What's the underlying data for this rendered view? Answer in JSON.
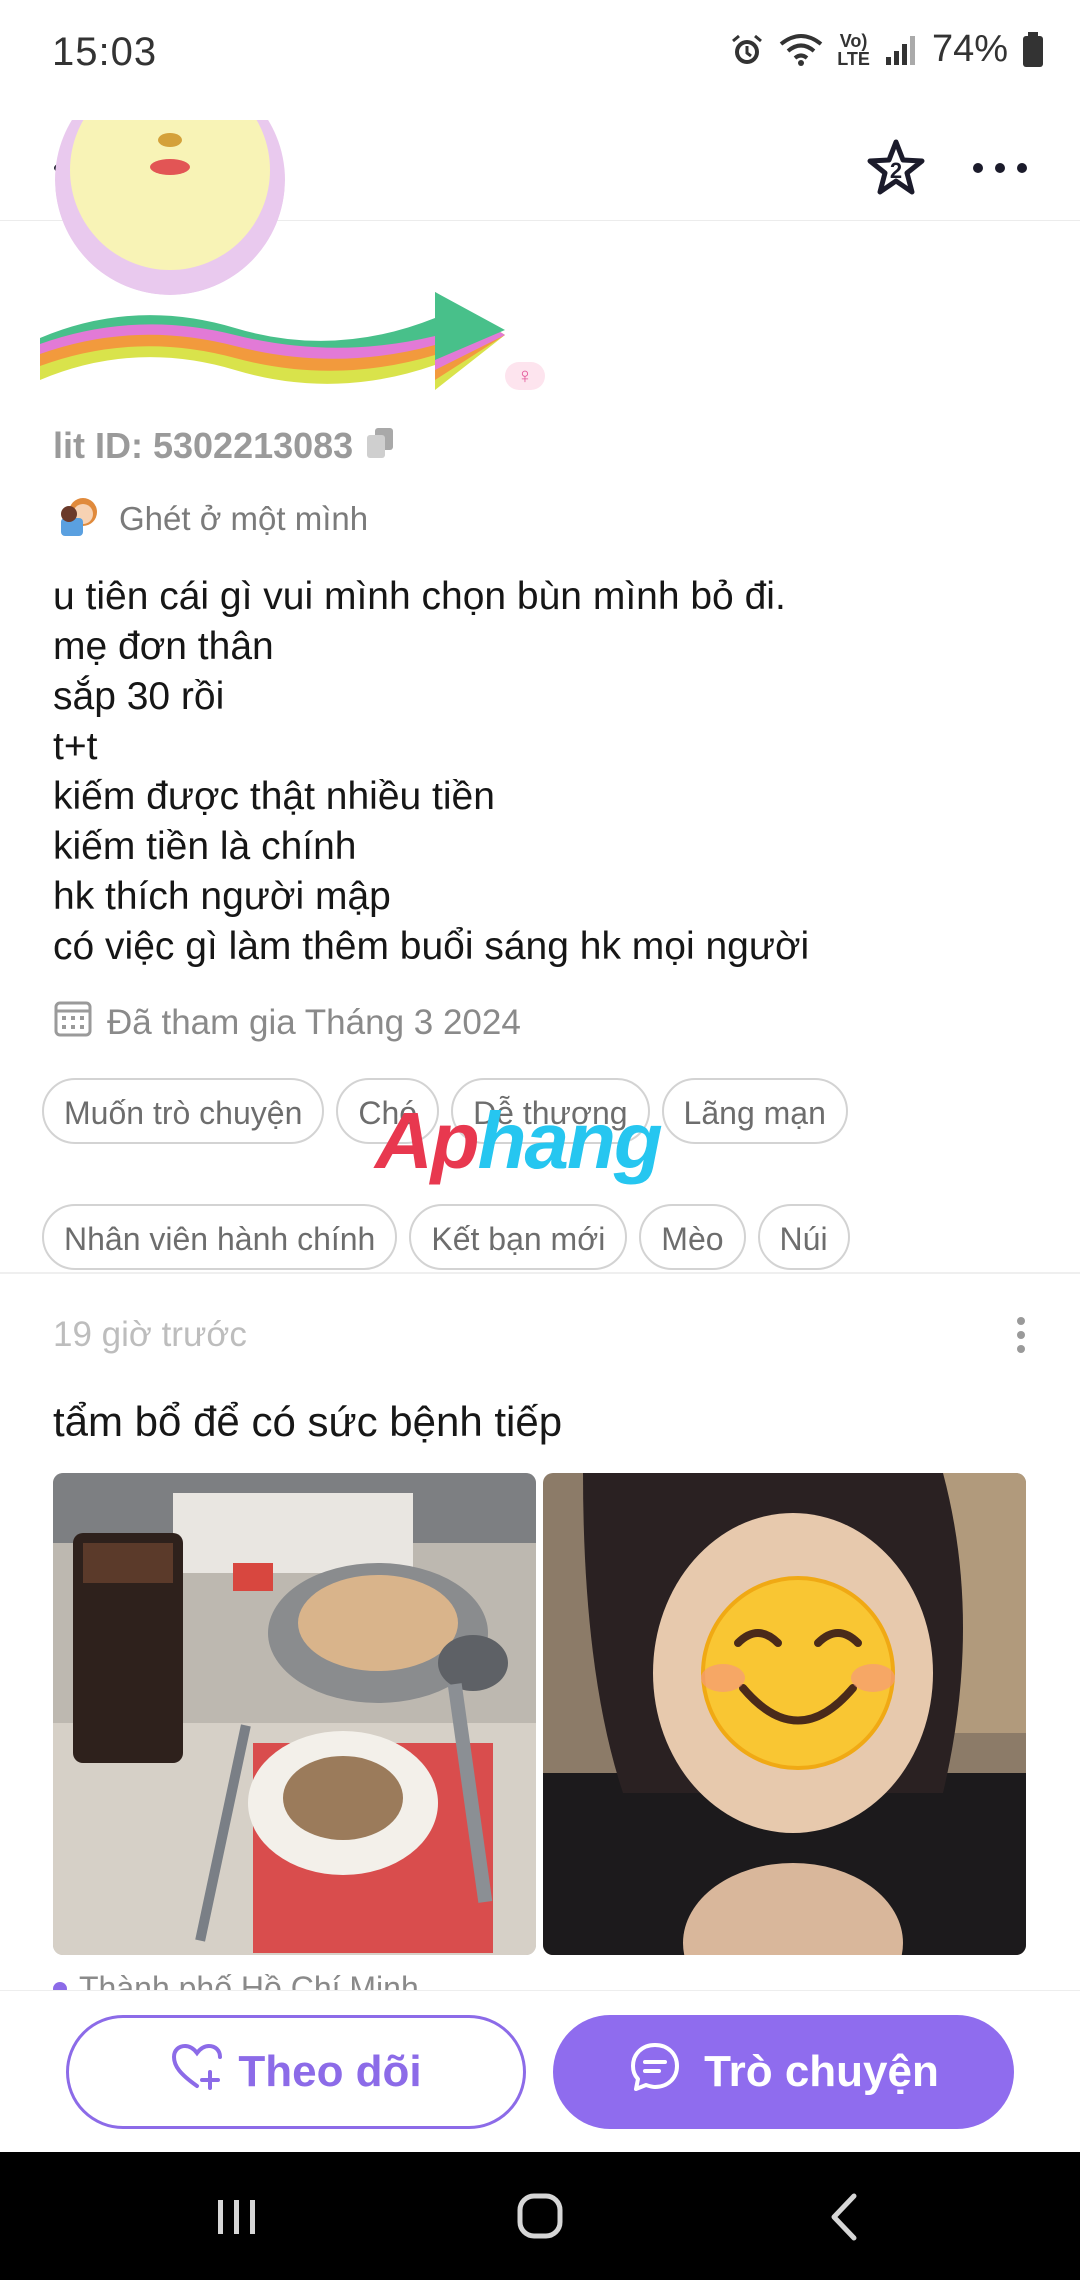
{
  "status_bar": {
    "time": "15:03",
    "network": "LTE",
    "battery": "74%",
    "icons": [
      "alarm-icon",
      "wifi-icon",
      "volte-icon",
      "signal-icon",
      "battery-icon"
    ]
  },
  "app_bar": {
    "icons": [
      "back-arrow-icon",
      "star-badge-icon",
      "more-horizontal-icon"
    ],
    "star_badge_count": "2"
  },
  "profile": {
    "lit_id": "lit ID: 5302213083",
    "gender_icon": "female-icon",
    "mood": "Ghét ở một mình",
    "bio_lines": [
      "u tiên cái gì vui mình chọn bùn mình bỏ đi.",
      "mẹ đơn thân",
      "sắp 30 rồi",
      "t+t",
      "kiếm được thật nhiều tiền",
      "kiếm tiền là chính",
      "hk thích người mập",
      "có việc gì làm thêm buổi sáng hk mọi người"
    ],
    "joined": "Đã tham gia Tháng 3 2024",
    "tags_row1": [
      "Muốn trò chuyện",
      "Chó",
      "Dễ thương",
      "Lãng mạn"
    ],
    "tags_row2": [
      "Nhân viên hành chính",
      "Kết bạn mới",
      "Mèo",
      "Núi"
    ]
  },
  "watermark": {
    "part1": "Ap",
    "part2": "hang"
  },
  "post": {
    "time": "19 giờ trước",
    "text": "tẩm bổ để có sức bệnh tiếp",
    "location": "Thành phố Hồ Chí Minh"
  },
  "actions": {
    "follow_label": "Theo dõi",
    "chat_label": "Trò chuyện"
  },
  "colors": {
    "accent": "#8f6cee",
    "tag_border": "#d3d3d3",
    "muted_text": "#8a8a8a"
  }
}
